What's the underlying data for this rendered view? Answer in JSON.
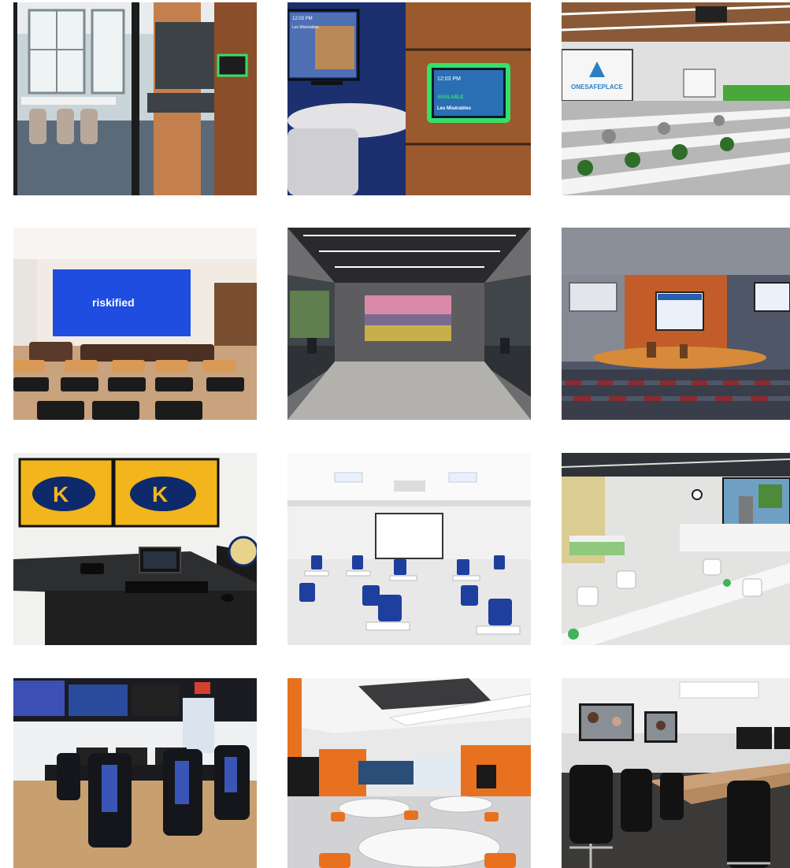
{
  "gallery": {
    "tiles": [
      {
        "scene": "glass-conference-room-with-door-panel"
      },
      {
        "scene": "huddle-room-with-green-lit-room-scheduler",
        "tv_time": "12:03 PM",
        "tv_room": "Les Misérables",
        "panel_time": "12:03 PM",
        "panel_status": "AVAILABLE",
        "panel_room": "Les Misérables"
      },
      {
        "scene": "training-room-with-projectors",
        "screen_brand": "ONESAFEPLACE"
      },
      {
        "scene": "lounge-with-video-wall",
        "wall_text": "riskified"
      },
      {
        "scene": "boardroom-with-vineyard-display"
      },
      {
        "scene": "auditorium-with-three-screens"
      },
      {
        "scene": "control-desk-with-dual-kent-state-displays",
        "display_letter": "K"
      },
      {
        "scene": "classroom-with-projection-screen"
      },
      {
        "scene": "nursing-simulation-lab"
      },
      {
        "scene": "esports-arena-with-gaming-chairs"
      },
      {
        "scene": "collaborative-classroom-with-round-tables"
      },
      {
        "scene": "video-conference-boardroom"
      }
    ]
  },
  "colors": {
    "panel_glow": "#35e06a",
    "tv_blue": "#1a3c8f",
    "riskified_blue": "#1f4de0",
    "kent_gold": "#f2b51c",
    "kent_navy": "#0f2a6b",
    "chair_blue": "#1e3f9e",
    "accent_orange": "#e8711f"
  }
}
